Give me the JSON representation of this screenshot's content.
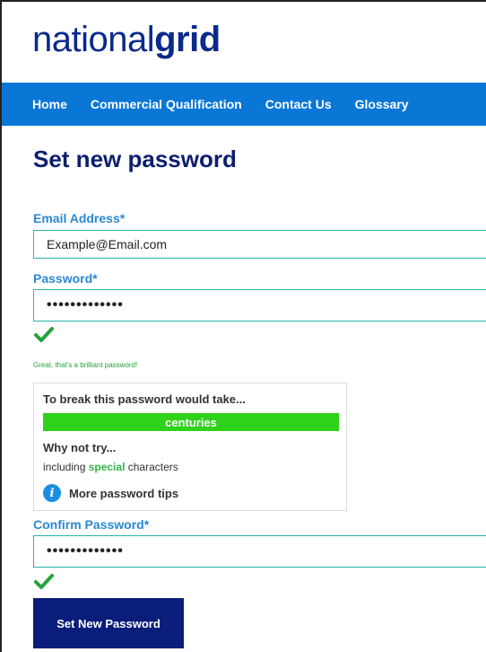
{
  "brand": {
    "part1": "national",
    "part2": "grid"
  },
  "nav": {
    "items": [
      {
        "label": "Home"
      },
      {
        "label": "Commercial Qualification"
      },
      {
        "label": "Contact Us"
      },
      {
        "label": "Glossary"
      }
    ]
  },
  "page": {
    "title": "Set new password"
  },
  "form": {
    "email": {
      "label": "Email Address*",
      "value": "Example@Email.com"
    },
    "password": {
      "label": "Password*",
      "value": "•••••••••••••"
    },
    "password_feedback": "Great, that's a brilliant password!",
    "strength": {
      "heading": "To break this password would take...",
      "meter_text": "centuries",
      "level": 1.0,
      "meter_color": "#2fd21a",
      "why_heading": "Why not try...",
      "suggestion_prefix": "including ",
      "suggestion_highlight": "special",
      "suggestion_suffix": " characters",
      "tips_link": "More password tips",
      "tips_icon": "info-icon"
    },
    "confirm": {
      "label": "Confirm Password*",
      "value": "•••••••••••••"
    },
    "submit_label": "Set New Password"
  },
  "colors": {
    "nav": "#0a77d6",
    "title": "#0c1f6e",
    "label": "#2a88d2",
    "field_border": "#2bb3a6",
    "success": "#24a33a",
    "button": "#0a1d7a"
  }
}
